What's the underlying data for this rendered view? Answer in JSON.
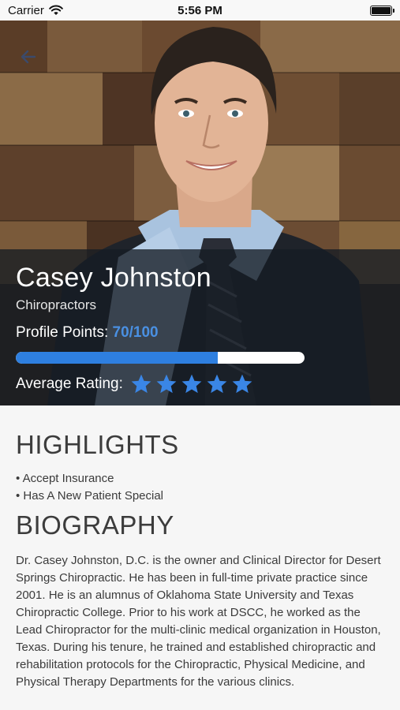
{
  "status_bar": {
    "carrier": "Carrier",
    "time": "5:56 PM",
    "icons": [
      "wifi-icon",
      "battery-icon"
    ]
  },
  "header": {
    "back_icon": "arrow-left-icon",
    "accent_color": "#2e7fe0"
  },
  "profile": {
    "name": "Casey Johnston",
    "category": "Chiropractors",
    "points_label": "Profile Points:",
    "points_value": "70/100",
    "points_fraction": 0.7,
    "rating_label": "Average Rating:",
    "rating_stars": 5,
    "rating_max": 5,
    "star_color": "#3a86e6"
  },
  "highlights": {
    "title": "HIGHLIGHTS",
    "items": [
      "• Accept Insurance",
      "• Has A New Patient Special"
    ]
  },
  "biography": {
    "title": "BIOGRAPHY",
    "text": "Dr. Casey Johnston, D.C. is the owner and Clinical Director for Desert Springs Chiropractic. He has been in full-time private practice since 2001. He is an alumnus of Oklahoma State University and Texas Chiropractic College. Prior to his work at DSCC, he worked as the Lead Chiropractor for the multi-clinic medical organization in Houston, Texas. During his tenure, he trained and established chiropractic and rehabilitation protocols for the Chiropractic, Physical Medicine, and Physical Therapy Departments for the various clinics."
  }
}
